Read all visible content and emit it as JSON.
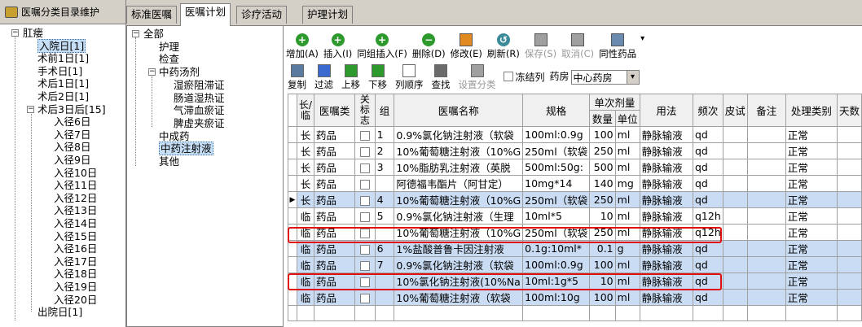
{
  "left_panel": {
    "title": "医嘱分类目录维护",
    "tree": [
      {
        "label": "肛瘘",
        "toggle": "−",
        "depth": 0
      },
      {
        "label": "入院日[1]",
        "depth": 1,
        "selected": true
      },
      {
        "label": "术前1日[1]",
        "depth": 1
      },
      {
        "label": "手术日[1]",
        "depth": 1
      },
      {
        "label": "术后1日[1]",
        "depth": 1
      },
      {
        "label": "术后2日[1]",
        "depth": 1
      },
      {
        "label": "术后3日后[15]",
        "toggle": "−",
        "depth": 1
      },
      {
        "label": "入径6日",
        "depth": 2
      },
      {
        "label": "入径7日",
        "depth": 2
      },
      {
        "label": "入径8日",
        "depth": 2
      },
      {
        "label": "入径9日",
        "depth": 2
      },
      {
        "label": "入径10日",
        "depth": 2
      },
      {
        "label": "入径11日",
        "depth": 2
      },
      {
        "label": "入径12日",
        "depth": 2
      },
      {
        "label": "入径13日",
        "depth": 2
      },
      {
        "label": "入径14日",
        "depth": 2
      },
      {
        "label": "入径15日",
        "depth": 2
      },
      {
        "label": "入径16日",
        "depth": 2
      },
      {
        "label": "入径17日",
        "depth": 2
      },
      {
        "label": "入径18日",
        "depth": 2
      },
      {
        "label": "入径19日",
        "depth": 2
      },
      {
        "label": "入径20日",
        "depth": 2
      },
      {
        "label": "出院日[1]",
        "depth": 1
      }
    ]
  },
  "tabs": [
    "标准医嘱",
    "医嘱计划",
    "诊疗活动",
    "护理计划"
  ],
  "active_tab": "医嘱计划",
  "category_tree": [
    {
      "label": "全部",
      "toggle": "−",
      "depth": 0
    },
    {
      "label": "护理",
      "depth": 1
    },
    {
      "label": "检查",
      "depth": 1
    },
    {
      "label": "中药汤剂",
      "toggle": "−",
      "depth": 1
    },
    {
      "label": "湿瘀阻滞证",
      "depth": 2
    },
    {
      "label": "肠道湿热证",
      "depth": 2
    },
    {
      "label": "气滞血瘀证",
      "depth": 2
    },
    {
      "label": "脾虚夹瘀证",
      "depth": 2
    },
    {
      "label": "中成药",
      "depth": 1
    },
    {
      "label": "中药注射液",
      "depth": 1,
      "selected": true
    },
    {
      "label": "其他",
      "depth": 1
    }
  ],
  "toolbar1": [
    {
      "name": "add",
      "label": "增加(A)",
      "icon": "plus-icon",
      "color": "#2e9a2e",
      "glyph": "+"
    },
    {
      "name": "insert",
      "label": "插入(I)",
      "icon": "plus-icon",
      "color": "#2e9a2e",
      "glyph": "+"
    },
    {
      "name": "group-insert",
      "label": "同组插入(F)",
      "icon": "plus-icon",
      "color": "#2e9a2e",
      "glyph": "+"
    },
    {
      "name": "delete",
      "label": "删除(D)",
      "icon": "minus-icon",
      "color": "#2e9a2e",
      "glyph": "−"
    },
    {
      "name": "modify",
      "label": "修改(E)",
      "icon": "eraser-icon",
      "color": "#e08a20",
      "glyph": ""
    },
    {
      "name": "refresh",
      "label": "刷新(R)",
      "icon": "refresh-icon",
      "color": "#3a8a9a",
      "glyph": "↺"
    },
    {
      "name": "save",
      "label": "保存(S)",
      "icon": "save-icon",
      "color": "#a0a0a0",
      "glyph": "",
      "disabled": true
    },
    {
      "name": "cancel",
      "label": "取消(C)",
      "icon": "cancel-icon",
      "color": "#a0a0a0",
      "glyph": "",
      "disabled": true
    },
    {
      "name": "same-drug",
      "label": "同性药品",
      "icon": "clipboard-icon",
      "color": "#6a8ab0",
      "glyph": ""
    }
  ],
  "toolbar2": [
    {
      "name": "copy",
      "label": "复制",
      "icon": "copy-icon",
      "color": "#5a7aa0"
    },
    {
      "name": "filter",
      "label": "过滤",
      "icon": "filter-icon",
      "color": "#3a6ad0"
    },
    {
      "name": "move-up",
      "label": "上移",
      "icon": "arrow-up-icon",
      "color": "#2e9a2e"
    },
    {
      "name": "move-down",
      "label": "下移",
      "icon": "arrow-down-icon",
      "color": "#2e9a2e"
    },
    {
      "name": "column-order",
      "label": "列顺序",
      "icon": "document-icon",
      "color": "#ffffff"
    },
    {
      "name": "find",
      "label": "查找",
      "icon": "magnifier-icon",
      "color": "#6a6a6a"
    },
    {
      "name": "set-category",
      "label": "设置分类",
      "icon": "settings-icon",
      "color": "#a0a0a0",
      "disabled": true
    }
  ],
  "freeze_label": "冻结列",
  "pharmacy_label": "药房",
  "pharmacy_value": "中心药房",
  "table": {
    "headers": [
      "长/临",
      "医嘱类",
      "关标志",
      "组",
      "医嘱名称",
      "规格",
      "单次剂量",
      "用法",
      "频次",
      "皮试",
      "备注",
      "处理类别",
      "天数"
    ],
    "subheaders": [
      "数量",
      "单位"
    ],
    "rows": [
      {
        "type": "长",
        "cls": "药品",
        "group": "1",
        "name": "0.9%氯化钠注射液（软袋",
        "spec": "100ml:0.9g",
        "qty": "100",
        "unit": "ml",
        "usage": "静脉输液",
        "freq": "qd",
        "proc": "正常",
        "blue": false
      },
      {
        "type": "长",
        "cls": "药品",
        "group": "2",
        "name": "10%葡萄糖注射液（10%G",
        "spec": "250ml（软袋",
        "qty": "250",
        "unit": "ml",
        "usage": "静脉输液",
        "freq": "qd",
        "proc": "正常",
        "blue": false
      },
      {
        "type": "长",
        "cls": "药品",
        "group": "3",
        "name": "10%脂肪乳注射液（英脱",
        "spec": "500ml:50g:",
        "qty": "500",
        "unit": "ml",
        "usage": "静脉输液",
        "freq": "qd",
        "proc": "正常",
        "blue": false
      },
      {
        "type": "长",
        "cls": "药品",
        "group": "",
        "name": "阿德福韦酯片（阿甘定）",
        "spec": "10mg*14",
        "qty": "140",
        "unit": "mg",
        "usage": "静脉输液",
        "freq": "qd",
        "proc": "正常",
        "blue": false
      },
      {
        "type": "长",
        "cls": "药品",
        "group": "4",
        "name": "10%葡萄糖注射液（10%G",
        "spec": "250ml（软袋",
        "qty": "250",
        "unit": "ml",
        "usage": "静脉输液",
        "freq": "qd",
        "proc": "正常",
        "blue": true,
        "current": true
      },
      {
        "type": "临",
        "cls": "药品",
        "group": "5",
        "name": "0.9%氯化钠注射液（生理",
        "spec": "10ml*5",
        "qty": "10",
        "unit": "ml",
        "usage": "静脉输液",
        "freq": "q12h",
        "proc": "正常",
        "blue": false
      },
      {
        "type": "临",
        "cls": "药品",
        "group": "",
        "name": "10%葡萄糖注射液（10%G",
        "spec": "250ml（软袋",
        "qty": "250",
        "unit": "ml",
        "usage": "静脉输液",
        "freq": "q12h",
        "proc": "正常",
        "blue": false
      },
      {
        "type": "临",
        "cls": "药品",
        "group": "6",
        "name": "1%盐酸普鲁卡因注射液",
        "spec": "0.1g:10ml*",
        "qty": "0.1",
        "unit": "g",
        "usage": "静脉输液",
        "freq": "qd",
        "proc": "正常",
        "blue": true
      },
      {
        "type": "临",
        "cls": "药品",
        "group": "7",
        "name": "0.9%氯化钠注射液（软袋",
        "spec": "100ml:0.9g",
        "qty": "100",
        "unit": "ml",
        "usage": "静脉输液",
        "freq": "qd",
        "proc": "正常",
        "blue": true
      },
      {
        "type": "临",
        "cls": "药品",
        "group": "",
        "name": "10%氯化钠注射液(10%Na",
        "spec": "10ml:1g*5",
        "qty": "10",
        "unit": "ml",
        "usage": "静脉输液",
        "freq": "qd",
        "proc": "正常",
        "blue": true
      },
      {
        "type": "临",
        "cls": "药品",
        "group": "",
        "name": "10%葡萄糖注射液（软袋",
        "spec": "100ml:10g",
        "qty": "100",
        "unit": "ml",
        "usage": "静脉输液",
        "freq": "qd",
        "proc": "正常",
        "blue": true
      }
    ]
  },
  "highlight_color": "#e01010",
  "selected_row_color": "#c9dcf4"
}
